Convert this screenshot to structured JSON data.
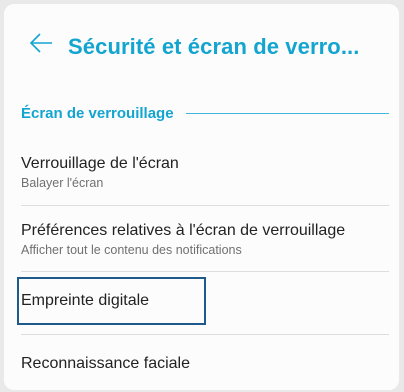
{
  "header": {
    "back_icon": "arrow-left-icon",
    "title": "Sécurité et écran de verro...",
    "accent_color": "#13a5d0"
  },
  "section": {
    "label": "Écran de verrouillage"
  },
  "items": [
    {
      "title": "Verrouillage de l'écran",
      "subtitle": "Balayer l'écran"
    },
    {
      "title": "Préférences relatives à l'écran de verrouillage",
      "subtitle": "Afficher tout le contenu des notifications"
    },
    {
      "title": "Empreinte digitale",
      "focused": true
    },
    {
      "title": "Reconnaissance faciale"
    }
  ]
}
